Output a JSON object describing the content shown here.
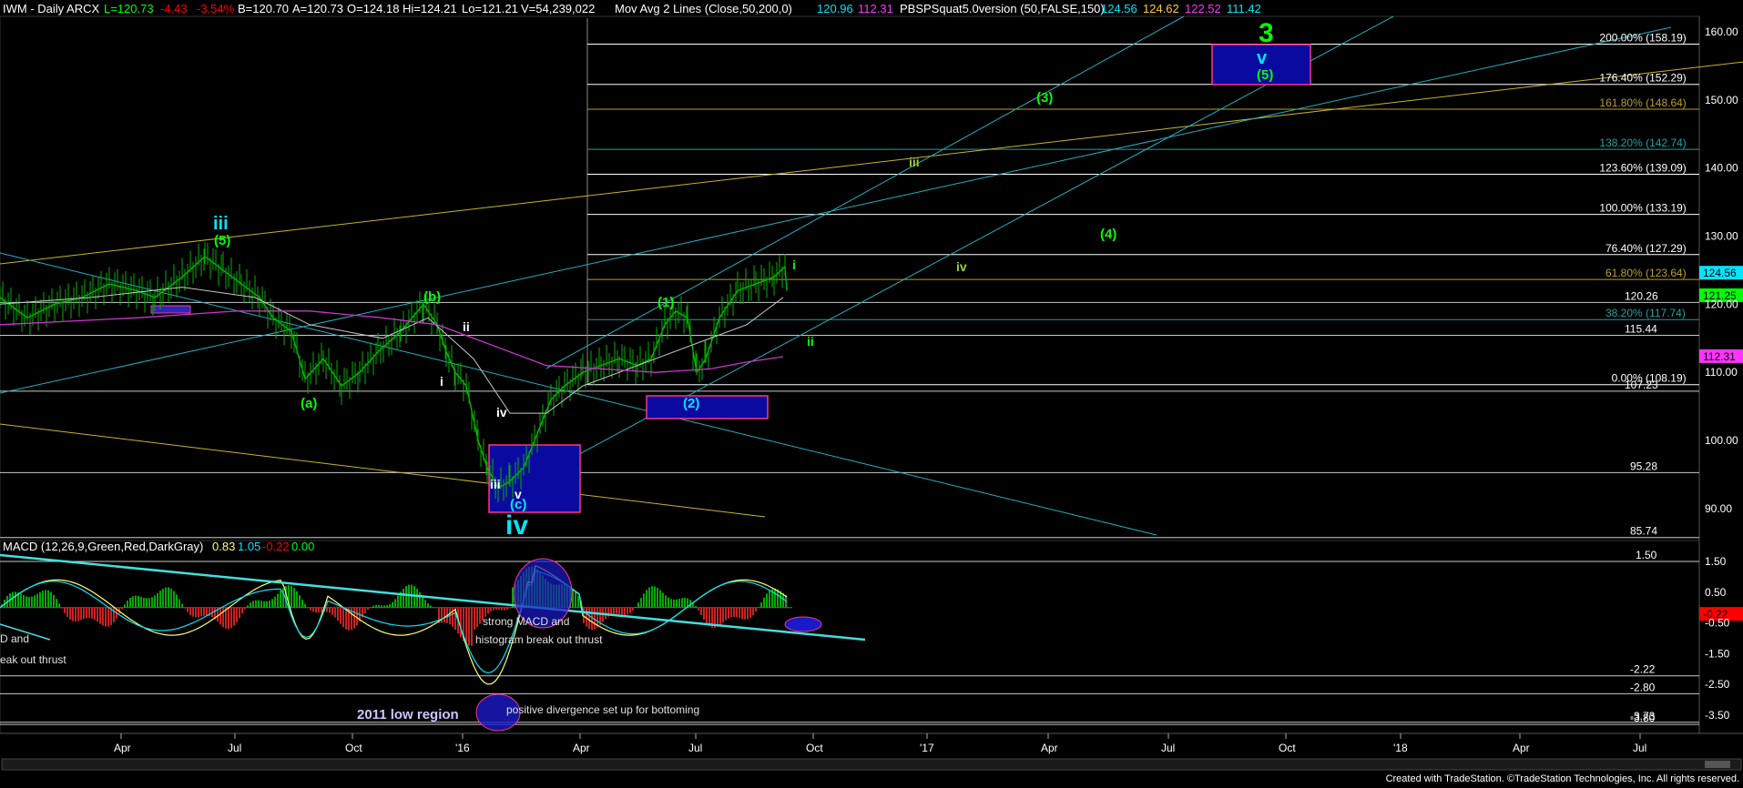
{
  "header": {
    "symbol": "IWM - Daily  ARCX",
    "L": "L=120.73",
    "chg": "-4.43",
    "pct": "-3.54%",
    "B": "B=120.70",
    "A": "A=120.73",
    "O": "O=124.18",
    "Hi": "Hi=124.21",
    "Lo": "Lo=121.21",
    "V": "V=54,239,022",
    "ma_label": "Mov Avg 2 Lines (Close,50,200,0)",
    "ma50": "120.96",
    "ma200": "112.31",
    "pbsp_label": "PBSPSquat5.0version (50,FALSE,150)",
    "pbsp1": "124.56",
    "pbsp2": "124.62",
    "pbsp3": "122.52",
    "pbsp4": "111.42"
  },
  "macd_header": {
    "label": "MACD (12,26,9,Green,Red,DarkGray)",
    "v1": "0.83",
    "v2": "1.05",
    "v3": "-0.22",
    "v4": "0.00"
  },
  "chart_data": {
    "type": "line",
    "title": "IWM - Daily ARCX",
    "x_tick_labels": [
      "Apr",
      "Jul",
      "Oct",
      "'16",
      "Apr",
      "Jul",
      "Oct",
      "'17",
      "Apr",
      "Jul",
      "Oct",
      "'18",
      "Apr",
      "Jul"
    ],
    "price_axis": {
      "ticks": [
        90,
        100,
        110,
        120,
        130,
        140,
        150,
        160
      ],
      "range": [
        86,
        163
      ]
    },
    "price_axis_labels": [
      "160.00",
      "150.00",
      "140.00",
      "130.00",
      "120.00",
      "110.00",
      "100.00",
      "90.00"
    ],
    "macd_axis": {
      "ticks": [
        1.5,
        0.5,
        -0.5,
        -1.5,
        -2.5,
        -3.5
      ],
      "range": [
        -3.9,
        1.8
      ]
    },
    "macd_axis_labels": [
      "1.50",
      "0.50",
      "-0.50",
      "-1.50",
      "-2.50",
      "-3.50"
    ],
    "last_price_tags": [
      {
        "text": "124.56",
        "color": "#00e5ff"
      },
      {
        "text": "121.25",
        "color": "#00ff00"
      },
      {
        "text": "112.31",
        "color": "#ff33ff"
      },
      {
        "text": "-0.22",
        "color": "#ff0000"
      }
    ],
    "fib_levels": [
      {
        "text": "200.00% (158.19)",
        "value": 158.19,
        "color": "#ffffff"
      },
      {
        "text": "176.40% (152.29)",
        "value": 152.29,
        "color": "#ffffff"
      },
      {
        "text": "161.80% (148.64)",
        "value": 148.64,
        "color": "#b8a020"
      },
      {
        "text": "138.20% (142.74)",
        "value": 142.74,
        "color": "#20a0a0"
      },
      {
        "text": "123.60% (139.09)",
        "value": 139.09,
        "color": "#ffffff"
      },
      {
        "text": "100.00% (133.19)",
        "value": 133.19,
        "color": "#ffffff"
      },
      {
        "text": "76.40% (127.29)",
        "value": 127.29,
        "color": "#ffffff"
      },
      {
        "text": "61.80% (123.64)",
        "value": 123.64,
        "color": "#b8a020"
      },
      {
        "text": "38.20% (117.74)",
        "value": 117.74,
        "color": "#20a0a0"
      },
      {
        "text": "0.00% (108.19)",
        "value": 108.19,
        "color": "#ffffff"
      }
    ],
    "horizontal_levels": [
      {
        "text": "120.26",
        "value": 120.26
      },
      {
        "text": "115.44",
        "value": 115.44
      },
      {
        "text": "107.23",
        "value": 107.23
      },
      {
        "text": "95.28",
        "value": 95.28
      },
      {
        "text": "85.74",
        "value": 85.74
      }
    ],
    "macd_levels": [
      {
        "text": "1.50",
        "value": 1.5
      },
      {
        "text": "-2.22",
        "value": -2.22
      },
      {
        "text": "-2.80",
        "value": -2.8
      },
      {
        "text": "-3.73",
        "value": -3.73
      },
      {
        "text": "-3.80",
        "value": -3.8
      }
    ],
    "wave_labels": [
      {
        "text": "iii",
        "color": "#00e5ff",
        "size": "big"
      },
      {
        "text": "(5)",
        "color": "#00ff00",
        "size": "mid"
      },
      {
        "text": "(b)",
        "color": "#00ff00",
        "size": "mid"
      },
      {
        "text": "(a)",
        "color": "#00ff00",
        "size": "mid"
      },
      {
        "text": "ii",
        "color": "#ffffff",
        "size": "small"
      },
      {
        "text": "i",
        "color": "#ffffff",
        "size": "small"
      },
      {
        "text": "iv",
        "color": "#ffffff",
        "size": "small"
      },
      {
        "text": "iii",
        "color": "#ffffff",
        "size": "small"
      },
      {
        "text": "v",
        "color": "#ffffff",
        "size": "small"
      },
      {
        "text": "(c)",
        "color": "#00e5ff",
        "size": "mid"
      },
      {
        "text": "iv",
        "color": "#00e5ff",
        "size": "huge"
      },
      {
        "text": "(1)",
        "color": "#00ff00",
        "size": "mid"
      },
      {
        "text": "(2)",
        "color": "#00e5ff",
        "size": "mid"
      },
      {
        "text": "i",
        "color": "#00ff00",
        "size": "small"
      },
      {
        "text": "ii",
        "color": "#00ff00",
        "size": "small"
      },
      {
        "text": "iii",
        "color": "#9acd32",
        "size": "small"
      },
      {
        "text": "iv",
        "color": "#9acd32",
        "size": "small"
      },
      {
        "text": "(3)",
        "color": "#00ff00",
        "size": "mid"
      },
      {
        "text": "(4)",
        "color": "#00ff00",
        "size": "mid"
      },
      {
        "text": "3",
        "color": "#00ff00",
        "size": "huge"
      },
      {
        "text": "v",
        "color": "#00e5ff",
        "size": "big"
      },
      {
        "text": "(5)",
        "color": "#00ff00",
        "size": "mid"
      }
    ],
    "annotations": [
      "strong MACD  and",
      "histogram break out thrust",
      "D and",
      "eak out thrust",
      "positive divergence set up for bottoming",
      "2011 low region"
    ]
  },
  "footer": {
    "credit": "Created with TradeStation. ©TradeStation Technologies, Inc. All rights reserved."
  }
}
